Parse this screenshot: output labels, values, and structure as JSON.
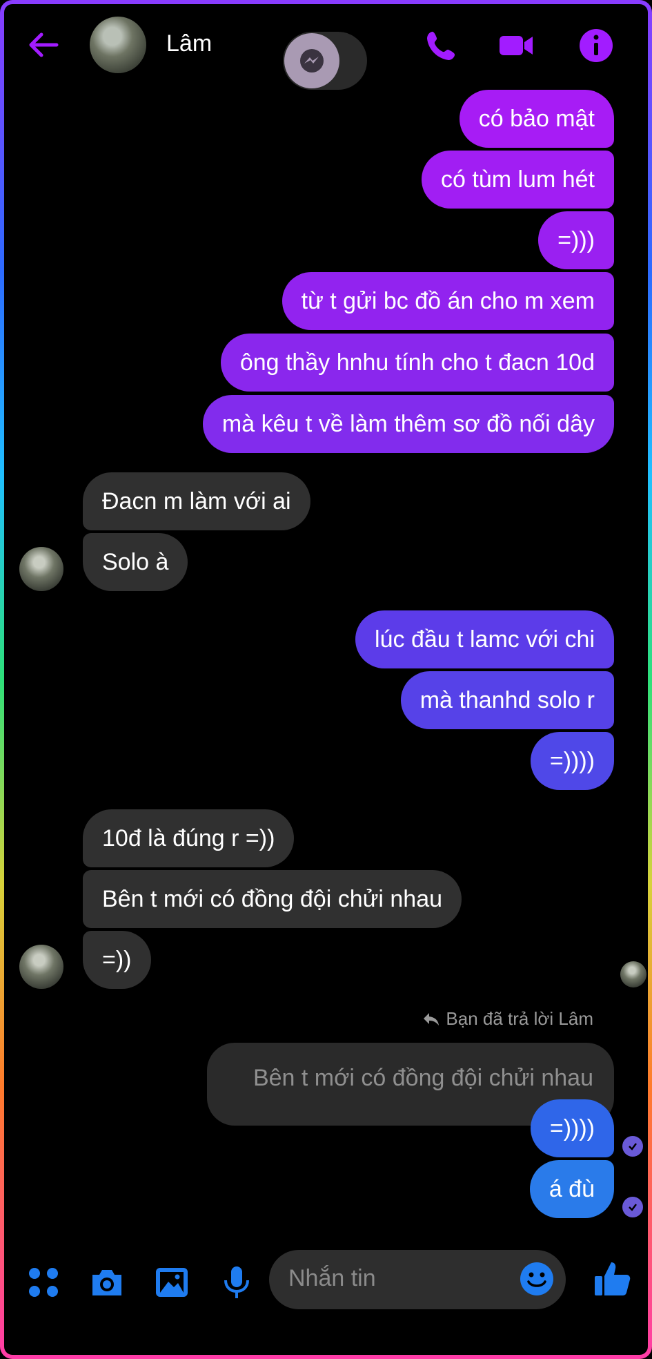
{
  "header": {
    "contact_name": "Lâm"
  },
  "messages": {
    "out1": [
      "có bảo mật",
      "có tùm lum hét",
      "=)))",
      "từ t gửi bc đồ án cho m xem",
      "ông thầy hnhu tính cho t đacn 10d",
      "mà kêu t về làm thêm sơ đồ nối dây"
    ],
    "in1": [
      "Đacn m làm với ai",
      "Solo à"
    ],
    "out2": [
      "lúc đầu t lamc với chi",
      "mà thanhd solo r",
      "=))))"
    ],
    "in2": [
      "10đ là đúng r =))",
      "Bên t mới có đồng đội chửi nhau",
      "=))"
    ],
    "reply_label": "Bạn đã trả lời Lâm",
    "reply_quote": "Bên t mới có đồng đội chửi nhau",
    "out3": [
      "=))))",
      "á đù"
    ]
  },
  "composer": {
    "placeholder": "Nhắn tin"
  },
  "colors": {
    "accent": "#9a1aff",
    "blue": "#2a7bea",
    "incoming": "#303030"
  }
}
